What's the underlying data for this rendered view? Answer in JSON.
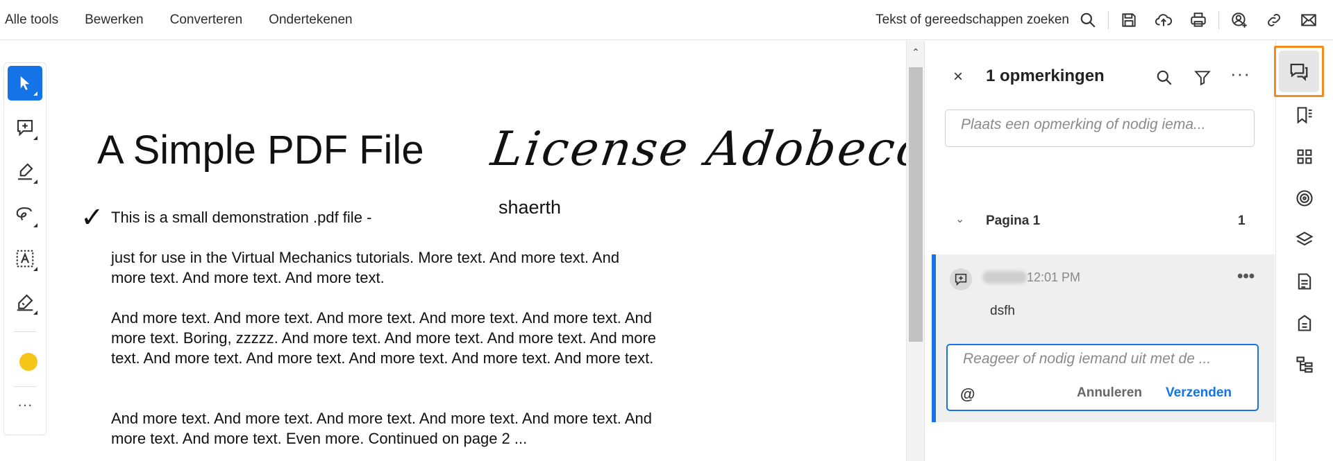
{
  "topnav": {
    "items": [
      "Alle tools",
      "Bewerken",
      "Converteren",
      "Ondertekenen"
    ]
  },
  "toolbar": {
    "search_label": "Tekst of gereedschappen zoeken",
    "icons": [
      "search-icon",
      "save-icon",
      "upload-cloud-icon",
      "print-icon",
      "share-user-icon",
      "link-icon",
      "mail-icon"
    ]
  },
  "tools": {
    "icons": [
      "select-pointer-icon",
      "add-comment-icon",
      "highlight-icon",
      "freehand-draw-icon",
      "text-box-icon",
      "sign-icon"
    ],
    "color": "#f5c518",
    "more": "···"
  },
  "document": {
    "title": "A Simple PDF File",
    "signature": "License Adobecc",
    "signer_name": "shaerth",
    "checkmark": "✓",
    "paragraphs": [
      "This is a small demonstration .pdf file -",
      "just for use in the Virtual Mechanics tutorials. More text. And more text. And more text. And more text. And more text.",
      "And more text. And more text. And more text. And more text. And more text. And more text. Boring, zzzzz. And more text. And more text. And more text. And more text. And more text. And more text. And more text. And more text. And more text.",
      "And more text. And more text. And more text. And more text. And more text. And more text. And more text. Even more. Continued on page 2 ..."
    ]
  },
  "comments_panel": {
    "close": "×",
    "title": "1 opmerkingen",
    "more": "···",
    "search_placeholder": "Plaats een opmerking of nodig iema...",
    "page_group": {
      "label": "Pagina 1",
      "count": "1"
    },
    "comment": {
      "time": "12:01 PM",
      "text": "dsfh",
      "more": "•••",
      "reply_placeholder": "Reageer of nodig iemand uit met de ...",
      "mention": "@",
      "cancel_label": "Annuleren",
      "send_label": "Verzenden"
    }
  },
  "right_rail": {
    "icons": [
      "comments-icon",
      "bookmarks-icon",
      "thumbnails-icon",
      "target-icon",
      "layers-icon",
      "document-icon",
      "document-info-icon",
      "structure-tree-icon"
    ],
    "active": "comments-icon",
    "accent": "#f28c1e"
  },
  "colors": {
    "accent_blue": "#1473e6",
    "highlight_yellow": "#f5c518",
    "active_outline": "#f28c1e"
  }
}
